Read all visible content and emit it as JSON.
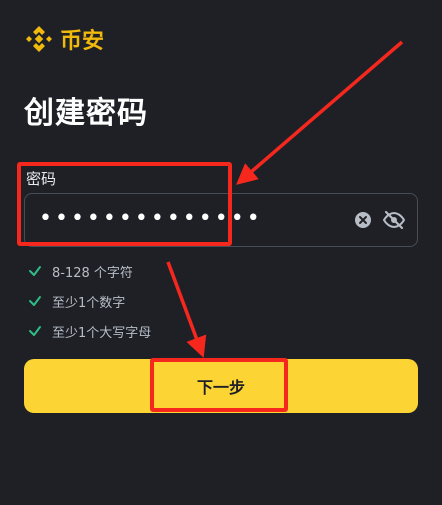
{
  "brand": {
    "name": "币安",
    "color": "#f0b90b",
    "icon": "binance-diamond-icon"
  },
  "page": {
    "title": "创建密码"
  },
  "password": {
    "label": "密码",
    "value": "••••••••••••••",
    "clear_icon": "clear-x-circle-icon",
    "visibility_icon": "eye-off-icon"
  },
  "rules": [
    {
      "text": "8-128 个字符",
      "met": true
    },
    {
      "text": "至少1个数字",
      "met": true
    },
    {
      "text": "至少1个大写字母",
      "met": true
    }
  ],
  "next_button": {
    "label": "下一步",
    "color": "#fcd535"
  },
  "annotation": {
    "color": "#f6281e",
    "type": "red-box-and-arrow"
  }
}
